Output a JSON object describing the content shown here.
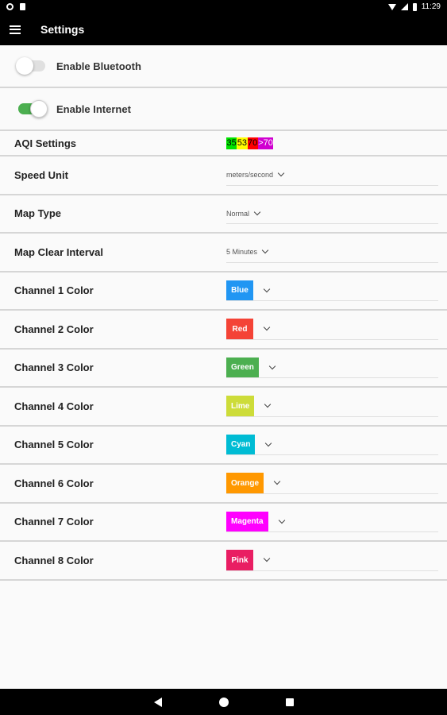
{
  "status_bar": {
    "time": "11:29"
  },
  "app_bar": {
    "title": "Settings"
  },
  "toggles": [
    {
      "label": "Enable Bluetooth",
      "on": false
    },
    {
      "label": "Enable Internet",
      "on": true
    }
  ],
  "aqi": {
    "label": "AQI Settings",
    "segments": [
      {
        "text": "35",
        "color": "#00e400",
        "text_color": "#000000"
      },
      {
        "text": "53",
        "color": "#ffff00",
        "text_color": "#000000"
      },
      {
        "text": "70",
        "color": "#ff0000",
        "text_color": "#000000"
      },
      {
        "text": ">70",
        "color": "#d000d0",
        "text_color": "#ffffff"
      }
    ]
  },
  "speed_unit": {
    "label": "Speed Unit",
    "value": "meters/second"
  },
  "map_type": {
    "label": "Map Type",
    "value": "Normal"
  },
  "map_clear": {
    "label": "Map Clear Interval",
    "value": "5 Minutes"
  },
  "channels": [
    {
      "label": "Channel 1 Color",
      "value": "Blue",
      "color": "#2196f3"
    },
    {
      "label": "Channel 2 Color",
      "value": "Red",
      "color": "#f44336"
    },
    {
      "label": "Channel 3 Color",
      "value": "Green",
      "color": "#4caf50"
    },
    {
      "label": "Channel 4 Color",
      "value": "Lime",
      "color": "#cddc39"
    },
    {
      "label": "Channel 5 Color",
      "value": "Cyan",
      "color": "#00bcd4"
    },
    {
      "label": "Channel 6 Color",
      "value": "Orange",
      "color": "#ff9800"
    },
    {
      "label": "Channel 7 Color",
      "value": "Magenta",
      "color": "#ff00ff"
    },
    {
      "label": "Channel 8 Color",
      "value": "Pink",
      "color": "#e91e63"
    }
  ]
}
